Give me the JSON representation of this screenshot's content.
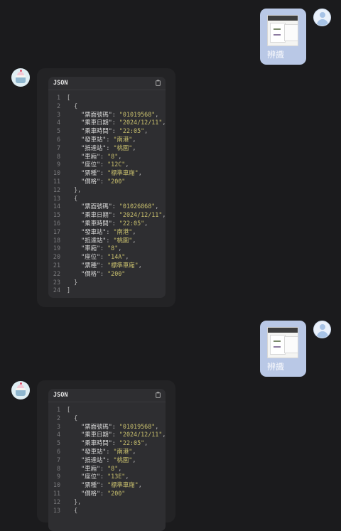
{
  "conversation": [
    {
      "role": "user",
      "label": "辨識",
      "image": "ticket-photo"
    },
    {
      "role": "assistant",
      "code_lang": "JSON",
      "lines": [
        "[",
        "  {",
        "    \"票面號碼\": \"01019568\",",
        "    \"乘車日期\": \"2024/12/11\",",
        "    \"乘車時間\": \"22:05\",",
        "    \"發車站\": \"南港\",",
        "    \"抵達站\": \"桃園\",",
        "    \"車廂\": \"8\",",
        "    \"座位\": \"12C\",",
        "    \"票種\": \"標準車廂\",",
        "    \"價格\": \"200\"",
        "  },",
        "  {",
        "    \"票面號碼\": \"01026868\",",
        "    \"乘車日期\": \"2024/12/11\",",
        "    \"乘車時間\": \"22:05\",",
        "    \"發車站\": \"南港\",",
        "    \"抵達站\": \"桃園\",",
        "    \"車廂\": \"8\",",
        "    \"座位\": \"14A\",",
        "    \"票種\": \"標準車廂\",",
        "    \"價格\": \"200\"",
        "  }",
        "]"
      ]
    },
    {
      "role": "user",
      "label": "辨識",
      "image": "ticket-photo"
    },
    {
      "role": "assistant",
      "code_lang": "JSON",
      "lines": [
        "[",
        "  {",
        "    \"票面號碼\": \"01019568\",",
        "    \"乘車日期\": \"2024/12/11\",",
        "    \"乘車時間\": \"22:05\",",
        "    \"發車站\": \"南港\",",
        "    \"抵達站\": \"桃園\",",
        "    \"車廂\": \"8\",",
        "    \"座位\": \"13E\",",
        "    \"票種\": \"標準車廂\",",
        "    \"價格\": \"200\"",
        "  },",
        "  {"
      ]
    }
  ],
  "icons": {
    "user_avatar": "user-avatar-icon",
    "bot_avatar": "cupcake-avatar-icon",
    "copy": "copy-icon"
  },
  "colors": {
    "background": "#1b1b1d",
    "user_bubble": "#b9c8e6",
    "code_bg": "#2e2e31",
    "string": "#c9c06e"
  }
}
